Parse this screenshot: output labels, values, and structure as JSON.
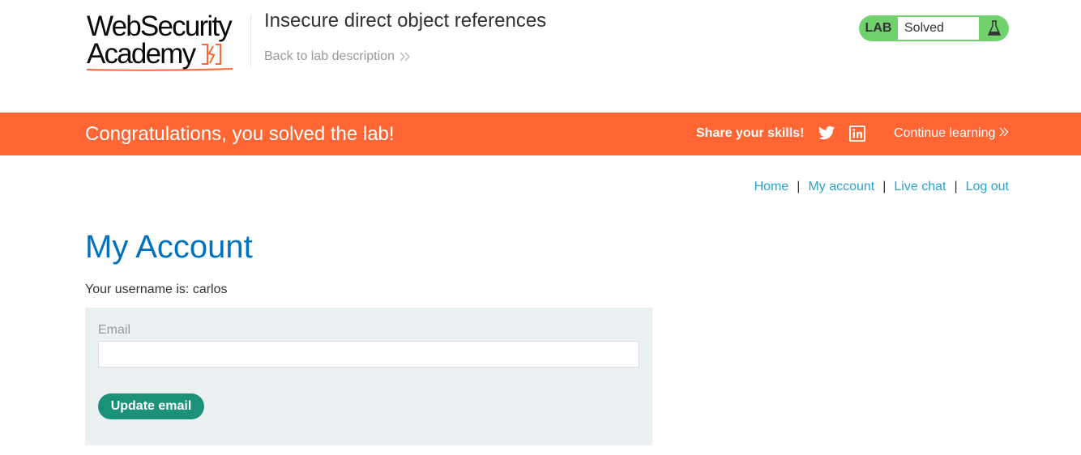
{
  "header": {
    "logo_line1": "WebSecurity",
    "logo_line2": "Academy",
    "lab_title": "Insecure direct object references",
    "back_link": "Back to lab description",
    "lab_tag": "LAB",
    "lab_state": "Solved"
  },
  "banner": {
    "message": "Congratulations, you solved the lab!",
    "share": "Share your skills!",
    "continue": "Continue learning"
  },
  "nav": {
    "home": "Home",
    "my_account": "My account",
    "live_chat": "Live chat",
    "log_out": "Log out",
    "separator": "|"
  },
  "main": {
    "title": "My Account",
    "username_line": "Your username is: carlos",
    "email_label": "Email",
    "email_value": "",
    "update_button": "Update email"
  },
  "colors": {
    "accent_orange": "#ff6633",
    "link_blue": "#29a2cc",
    "title_blue": "#0071bc",
    "solved_green": "#70d16d",
    "button_green": "#1a9178"
  },
  "icons": [
    "bolt-icon",
    "chevron-double-right-icon",
    "flask-icon",
    "twitter-icon",
    "linkedin-icon"
  ]
}
